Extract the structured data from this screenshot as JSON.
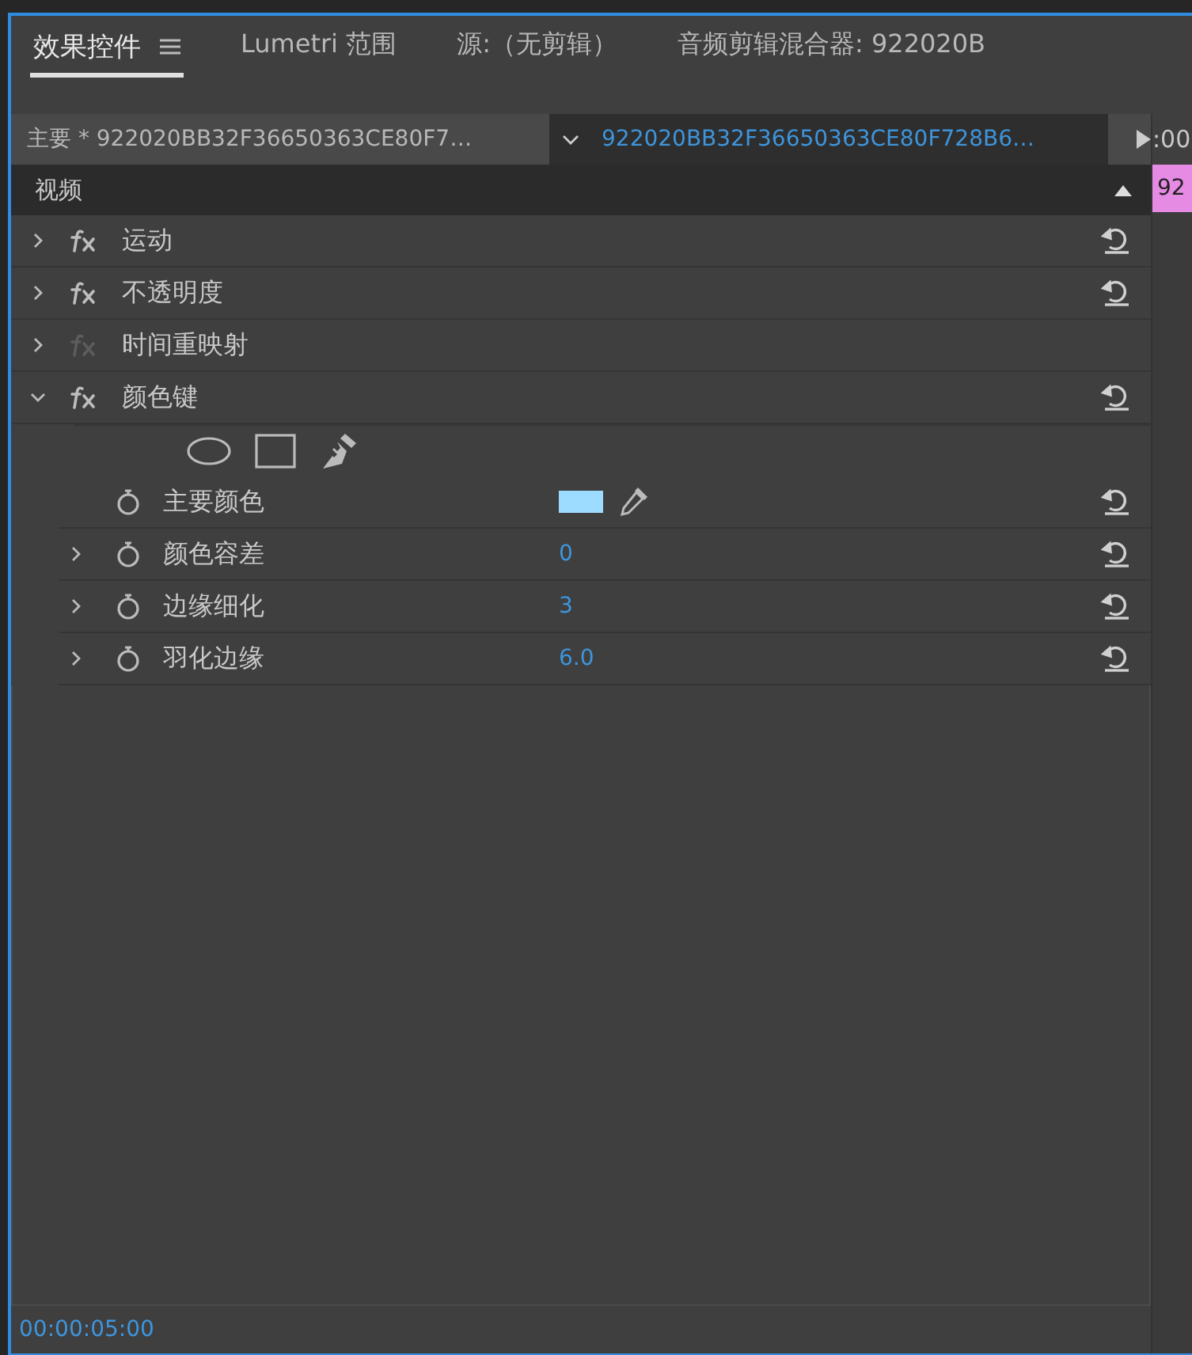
{
  "tabs": [
    {
      "label": "效果控件",
      "selected": true,
      "menu": true
    },
    {
      "label": "Lumetri 范围",
      "selected": false,
      "menu": false
    },
    {
      "label": "源:（无剪辑）",
      "selected": false,
      "menu": false
    },
    {
      "label": "音频剪辑混合器: 922020B",
      "selected": false,
      "menu": false
    }
  ],
  "clip_header": {
    "master_clip": "主要 * 922020BB32F36650363CE80F7…",
    "sequence_clip": "922020BB32F36650363CE80F728B6…"
  },
  "timeline": {
    "timecode": ":00",
    "clip_label": "92"
  },
  "section": {
    "title": "视频",
    "collapsed": false
  },
  "effects": [
    {
      "name": "运动",
      "expanded": false,
      "fx_enabled": true,
      "resettable": true
    },
    {
      "name": "不透明度",
      "expanded": false,
      "fx_enabled": true,
      "resettable": true
    },
    {
      "name": "时间重映射",
      "expanded": false,
      "fx_enabled": false,
      "resettable": false
    },
    {
      "name": "颜色键",
      "expanded": true,
      "fx_enabled": true,
      "resettable": true,
      "mask_tools": true,
      "properties": [
        {
          "kind": "color",
          "name": "主要颜色",
          "expandable": false,
          "color": "#9ddcff"
        },
        {
          "kind": "value",
          "name": "颜色容差",
          "expandable": true,
          "value": "0"
        },
        {
          "kind": "value",
          "name": "边缘细化",
          "expandable": true,
          "value": "3"
        },
        {
          "kind": "value",
          "name": "羽化边缘",
          "expandable": true,
          "value": "6.0"
        }
      ]
    }
  ],
  "status_bar": {
    "timecode": "00:00:05:00"
  }
}
